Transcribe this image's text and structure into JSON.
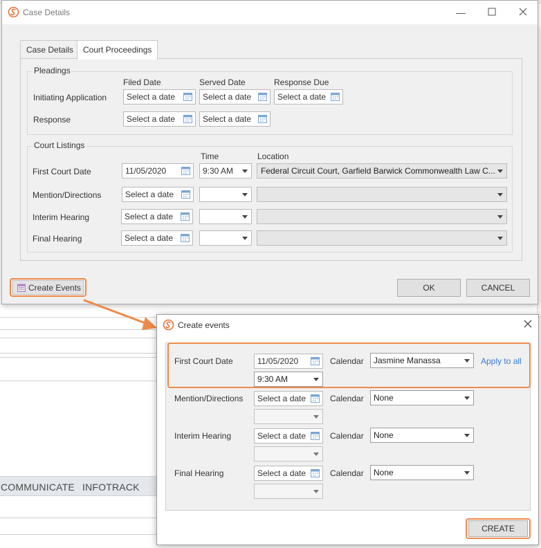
{
  "background_app": {
    "nav_items": [
      "COMMUNICATE",
      "INFOTRACK"
    ]
  },
  "case_details_dialog": {
    "title": "Case Details",
    "tabs": [
      {
        "label": "Case Details",
        "active": false
      },
      {
        "label": "Court Proceedings",
        "active": true
      }
    ],
    "pleadings": {
      "legend": "Pleadings",
      "columns": {
        "filed": "Filed Date",
        "served": "Served Date",
        "response_due": "Response Due"
      },
      "rows": [
        {
          "label": "Initiating Application",
          "filed": "Select a date",
          "served": "Select a date",
          "response_due": "Select a date"
        },
        {
          "label": "Response",
          "filed": "Select a date",
          "served": "Select a date"
        }
      ]
    },
    "court_listings": {
      "legend": "Court Listings",
      "columns": {
        "time": "Time",
        "location": "Location"
      },
      "rows": [
        {
          "label": "First Court Date",
          "date": "11/05/2020",
          "time": "9:30 AM",
          "location": "Federal Circuit Court, Garfield Barwick Commonwealth Law C..."
        },
        {
          "label": "Mention/Directions",
          "date": "Select a date",
          "time": "",
          "location": ""
        },
        {
          "label": "Interim Hearing",
          "date": "Select a date",
          "time": "",
          "location": ""
        },
        {
          "label": "Final Hearing",
          "date": "Select a date",
          "time": "",
          "location": ""
        }
      ]
    },
    "create_events_button": "Create Events",
    "ok_button": "OK",
    "cancel_button": "CANCEL"
  },
  "create_events_dialog": {
    "title": "Create events",
    "calendar_label": "Calendar",
    "apply_all": "Apply to all",
    "rows": [
      {
        "label": "First Court Date",
        "date": "11/05/2020",
        "time": "9:30 AM",
        "calendar": "Jasmine Manassa"
      },
      {
        "label": "Mention/Directions",
        "date": "Select a date",
        "time": "",
        "calendar": "None"
      },
      {
        "label": "Interim Hearing",
        "date": "Select a date",
        "time": "",
        "calendar": "None"
      },
      {
        "label": "Final Hearing",
        "date": "Select a date",
        "time": "",
        "calendar": "None"
      }
    ],
    "create_button": "CREATE"
  },
  "colors": {
    "highlight": "#ee8a4a",
    "logo": "#e8743b",
    "link": "#3a7bd5"
  }
}
